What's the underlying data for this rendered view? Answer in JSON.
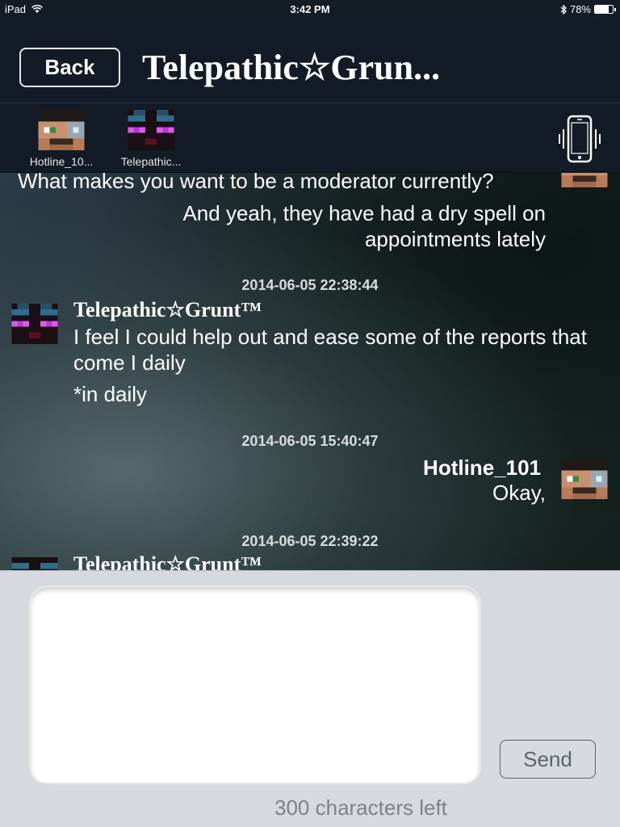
{
  "status_bar": {
    "device": "iPad",
    "time": "3:42 PM",
    "battery_percent": "78%",
    "battery_level": 0.78,
    "icons": [
      "wifi-icon",
      "bluetooth-icon",
      "battery-icon"
    ]
  },
  "nav": {
    "back_label": "Back",
    "title": "Telepathic☆Grun..."
  },
  "participants": [
    {
      "label": "Hotline_10...",
      "avatar": "hotline-avatar"
    },
    {
      "label": "Telepathic...",
      "avatar": "telepathic-avatar"
    }
  ],
  "messages": {
    "partial_top": "What makes you want to be a moderator currently?",
    "top_right_line": "And yeah, they have had a dry spell on appointments lately",
    "group1": {
      "timestamp": "2014-06-05 22:38:44",
      "sender": "Telepathic☆Grunt™",
      "line1": "I feel I could help out and ease some of the reports that come I daily",
      "line2": "*in daily"
    },
    "group2": {
      "timestamp": "2014-06-05 15:40:47",
      "sender": "Hotline_101",
      "line1": "Okay,"
    },
    "group3": {
      "timestamp": "2014-06-05 22:39:22",
      "sender": "Telepathic☆Grunt™"
    }
  },
  "compose": {
    "send_label": "Send",
    "chars_left": "300 characters left"
  },
  "colors": {
    "nav_bg": "#131b26",
    "compose_bg": "#d6d9dd",
    "text_light": "#ffffff"
  }
}
